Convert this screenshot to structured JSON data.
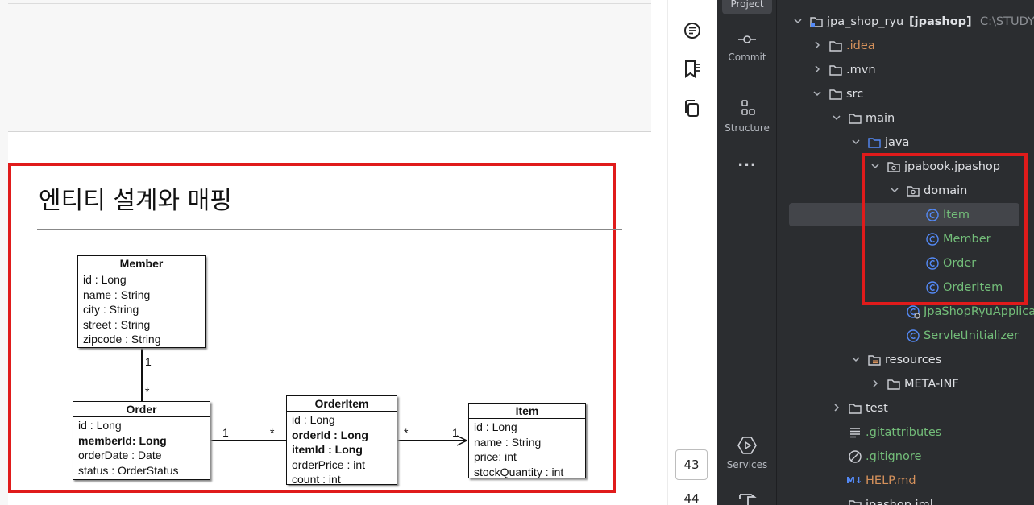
{
  "slide": {
    "title": "엔티티 설계와 매핑",
    "member": {
      "name": "Member",
      "attrs": [
        {
          "text": "id : Long",
          "bold": false
        },
        {
          "text": "name : String",
          "bold": false
        },
        {
          "text": "city : String",
          "bold": false
        },
        {
          "text": "street : String",
          "bold": false
        },
        {
          "text": "zipcode : String",
          "bold": false
        }
      ]
    },
    "order": {
      "name": "Order",
      "attrs": [
        {
          "text": "id : Long",
          "bold": false
        },
        {
          "text": "memberId: Long",
          "bold": true
        },
        {
          "text": "orderDate : Date",
          "bold": false
        },
        {
          "text": "status : OrderStatus",
          "bold": false
        }
      ]
    },
    "orderitem": {
      "name": "OrderItem",
      "attrs": [
        {
          "text": "id : Long",
          "bold": false
        },
        {
          "text": "orderId : Long",
          "bold": true
        },
        {
          "text": "itemId : Long",
          "bold": true
        },
        {
          "text": "orderPrice : int",
          "bold": false
        },
        {
          "text": "count : int",
          "bold": false
        }
      ]
    },
    "item": {
      "name": "Item",
      "attrs": [
        {
          "text": "id : Long",
          "bold": false
        },
        {
          "text": "name : String",
          "bold": false
        },
        {
          "text": "price: int",
          "bold": false
        },
        {
          "text": "stockQuantity : int",
          "bold": false
        }
      ]
    },
    "multiplicity": {
      "member_order_top": "1",
      "member_order_bottom": "*",
      "order_orderitem_left": "1",
      "order_orderitem_right": "*",
      "orderitem_item_left": "*",
      "orderitem_item_right": "1"
    }
  },
  "viewer": {
    "page_current": "43",
    "page_next": "44"
  },
  "ide_strip": {
    "project_label": "Project",
    "commit_label": "Commit",
    "structure_label": "Structure",
    "more_label": "...",
    "services_label": "Services"
  },
  "tree": {
    "root": {
      "name": "jpa_shop_ryu",
      "module": "[jpashop]",
      "path": "C:\\STUDY\\j"
    },
    "rows": [
      {
        "label": ".idea",
        "color": "#d5915b"
      },
      {
        "label": ".mvn",
        "color": "#dfe1e5"
      },
      {
        "label": "src",
        "color": "#dfe1e5"
      },
      {
        "label": "main",
        "color": "#dfe1e5"
      },
      {
        "label": "java",
        "color": "#dfe1e5"
      },
      {
        "label": "jpabook.jpashop",
        "color": "#dfe1e5"
      },
      {
        "label": "domain",
        "color": "#dfe1e5"
      },
      {
        "label": "Item",
        "color": "#73bd79"
      },
      {
        "label": "Member",
        "color": "#73bd79"
      },
      {
        "label": "Order",
        "color": "#73bd79"
      },
      {
        "label": "OrderItem",
        "color": "#73bd79"
      },
      {
        "label": "JpaShopRyuApplica",
        "color": "#73bd79"
      },
      {
        "label": "ServletInitializer",
        "color": "#73bd79"
      },
      {
        "label": "resources",
        "color": "#dfe1e5"
      },
      {
        "label": "META-INF",
        "color": "#dfe1e5"
      },
      {
        "label": "test",
        "color": "#dfe1e5"
      },
      {
        "label": ".gitattributes",
        "color": "#73bd79"
      },
      {
        "label": ".gitignore",
        "color": "#73bd79"
      },
      {
        "label": "HELP.md",
        "color": "#d5915b"
      },
      {
        "label": "jpashop.iml",
        "color": "#dfe1e5"
      }
    ],
    "md_badge": "M↓",
    "icons": {
      "folder": "folder-icon",
      "package": "package-icon",
      "class": "class-icon",
      "spring_app": "spring-app-icon",
      "resources": "resources-folder-icon",
      "text_file": "text-file-icon",
      "ignore_file": "ignore-file-icon",
      "markdown": "markdown-icon"
    },
    "colors": {
      "background": "#2b2d30",
      "selection": "#43454a",
      "highlight": "#e01b1b",
      "class_icon": "#548af7"
    }
  }
}
